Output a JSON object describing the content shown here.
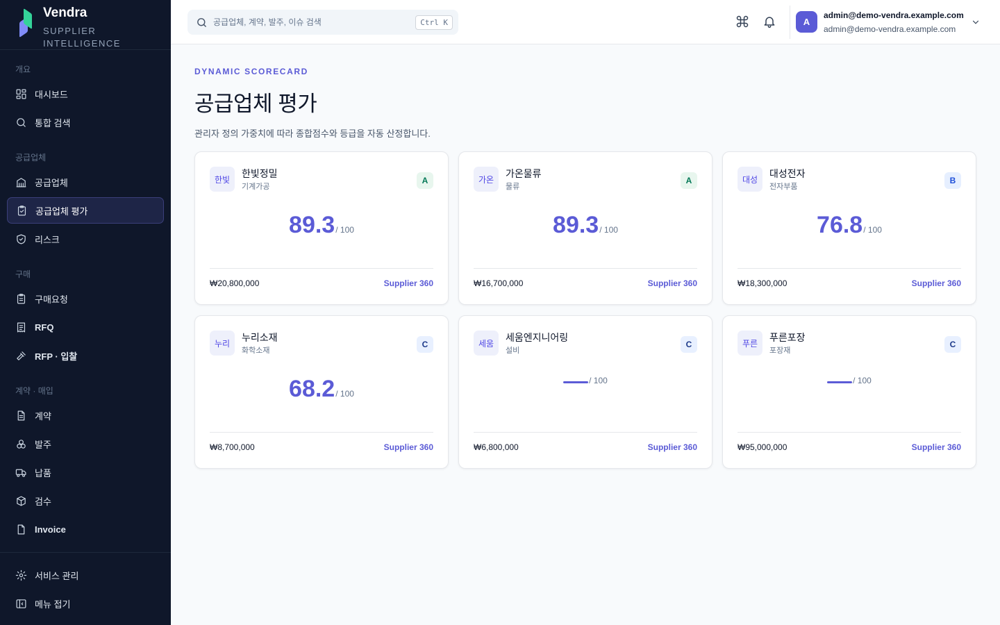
{
  "brand": {
    "name": "Vendra",
    "tagline_1": "SUPPLIER",
    "tagline_2": "INTELLIGENCE"
  },
  "sidebar": {
    "sections": [
      {
        "label": "개요",
        "items": [
          {
            "label": "대시보드",
            "icon": "dashboard-icon"
          },
          {
            "label": "통합 검색",
            "icon": "search-icon"
          }
        ]
      },
      {
        "label": "공급업체",
        "items": [
          {
            "label": "공급업체",
            "icon": "building-icon"
          },
          {
            "label": "공급업체 평가",
            "icon": "clipboard-check-icon",
            "active": true
          },
          {
            "label": "리스크",
            "icon": "shield-icon"
          }
        ]
      },
      {
        "label": "구매",
        "items": [
          {
            "label": "구매요청",
            "icon": "clipboard-icon"
          },
          {
            "label": "RFQ",
            "icon": "receipt-icon"
          },
          {
            "label": "RFP · 입찰",
            "icon": "gavel-icon"
          }
        ]
      },
      {
        "label": "계약 · 매입",
        "items": [
          {
            "label": "계약",
            "icon": "document-icon"
          },
          {
            "label": "발주",
            "icon": "boxes-icon"
          },
          {
            "label": "납품",
            "icon": "truck-icon"
          },
          {
            "label": "검수",
            "icon": "package-icon"
          },
          {
            "label": "Invoice",
            "icon": "invoice-icon"
          }
        ]
      }
    ],
    "bottom": [
      {
        "label": "서비스 관리",
        "icon": "gear-icon"
      },
      {
        "label": "메뉴 접기",
        "icon": "collapse-icon"
      }
    ]
  },
  "topbar": {
    "search_placeholder": "공급업체, 계약, 발주, 이슈 검색",
    "shortcut": "Ctrl K",
    "user": {
      "avatar": "A",
      "name": "admin@demo-vendra.example.com",
      "email": "admin@demo-vendra.example.com"
    }
  },
  "page": {
    "eyebrow": "DYNAMIC SCORECARD",
    "title": "공급업체 평가",
    "subtitle": "관리자 정의 가중치에 따라 종합점수와 등급을 자동 산정합니다."
  },
  "colors": {
    "accent": "#5b5bd6",
    "sidebar_bg": "#0f172a",
    "grade_a": "#047857",
    "grade_b": "#1d4ed8",
    "grade_c": "#1e3a8a"
  },
  "suppliers": [
    {
      "abbr": "한빛",
      "name": "한빛정밀",
      "category": "기계가공",
      "grade": "A",
      "score": "89.3",
      "score_max": "/ 100",
      "amount": "₩20,800,000",
      "link": "Supplier 360"
    },
    {
      "abbr": "가온",
      "name": "가온물류",
      "category": "물류",
      "grade": "A",
      "score": "89.3",
      "score_max": "/ 100",
      "amount": "₩16,700,000",
      "link": "Supplier 360"
    },
    {
      "abbr": "대성",
      "name": "대성전자",
      "category": "전자부품",
      "grade": "B",
      "score": "76.8",
      "score_max": "/ 100",
      "amount": "₩18,300,000",
      "link": "Supplier 360"
    },
    {
      "abbr": "누리",
      "name": "누리소재",
      "category": "화학소재",
      "grade": "C",
      "score": "68.2",
      "score_max": "/ 100",
      "amount": "₩8,700,000",
      "link": "Supplier 360"
    },
    {
      "abbr": "세움",
      "name": "세움엔지니어링",
      "category": "설비",
      "grade": "C",
      "score": null,
      "score_max": "/ 100",
      "amount": "₩6,800,000",
      "link": "Supplier 360"
    },
    {
      "abbr": "푸른",
      "name": "푸른포장",
      "category": "포장재",
      "grade": "C",
      "score": null,
      "score_max": "/ 100",
      "amount": "₩95,000,000",
      "link": "Supplier 360"
    }
  ]
}
